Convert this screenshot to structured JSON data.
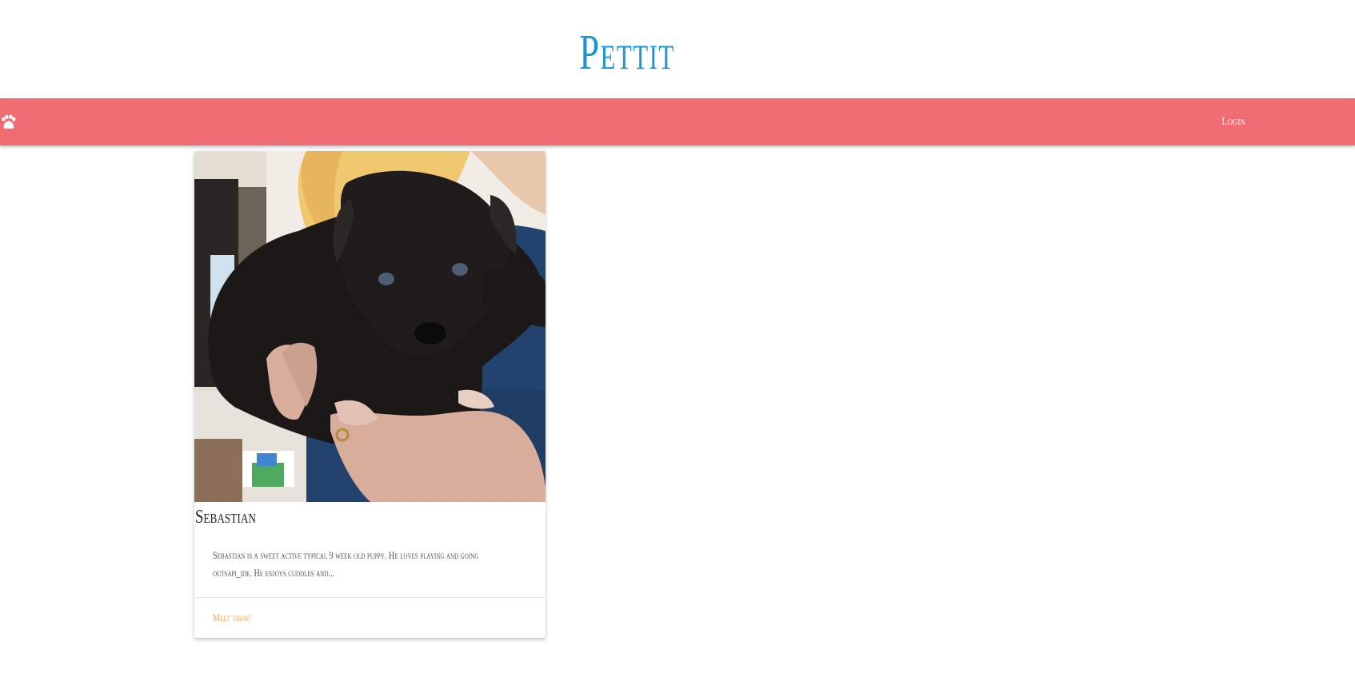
{
  "header": {
    "title": "Pettit",
    "title_color": "#1a96d4"
  },
  "navbar": {
    "background": "#ef6c73",
    "home_icon": "paw-icon",
    "login_label": "Login"
  },
  "pets": [
    {
      "name": "Sebastian",
      "description": "Sebastian is a sweet active typical 9 week old puppy. He loves playing and going outsapi_ide. He enjoys cuddles and...",
      "action_label": "Meet them!",
      "action_color": "#f2a25b",
      "photo_alt": "Black puppy held in hands"
    }
  ]
}
